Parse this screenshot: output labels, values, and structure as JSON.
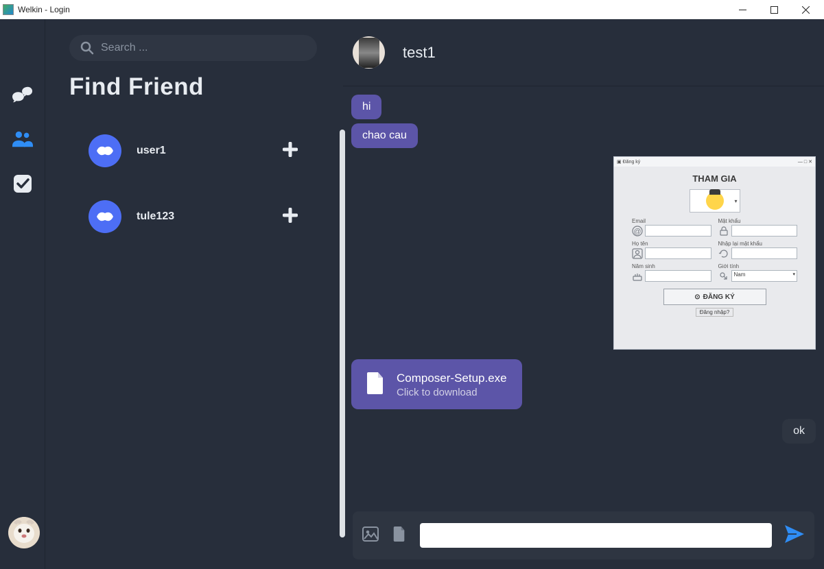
{
  "window": {
    "title": "Welkin - Login"
  },
  "rail": {
    "icons": [
      "chat-icon",
      "friends-icon",
      "tasks-icon"
    ]
  },
  "search": {
    "placeholder": "Search ..."
  },
  "panel": {
    "heading": "Find Friend",
    "friends": [
      {
        "name": "user1"
      },
      {
        "name": "tule123"
      }
    ]
  },
  "chat": {
    "contact_name": "test1",
    "messages": [
      {
        "side": "in",
        "type": "text",
        "text": "hi"
      },
      {
        "side": "in",
        "type": "text",
        "text": "chao cau"
      },
      {
        "side": "out",
        "type": "image",
        "image_form": {
          "window_title": "Đăng ký",
          "title": "THAM GIA",
          "fields": {
            "email": "Email",
            "password": "Mật khẩu",
            "fullname": "Họ tên",
            "password_repeat": "Nhập lại mật khẩu",
            "birthyear": "Năm sinh",
            "gender": "Giới tính",
            "gender_value": "Nam"
          },
          "submit": "ĐĂNG KÝ",
          "login_link": "Đăng nhập?"
        }
      },
      {
        "side": "in",
        "type": "file",
        "file_name": "Composer-Setup.exe",
        "file_sub": "Click to download"
      },
      {
        "side": "out",
        "type": "text",
        "text": "ok"
      }
    ],
    "composer_placeholder": ""
  }
}
